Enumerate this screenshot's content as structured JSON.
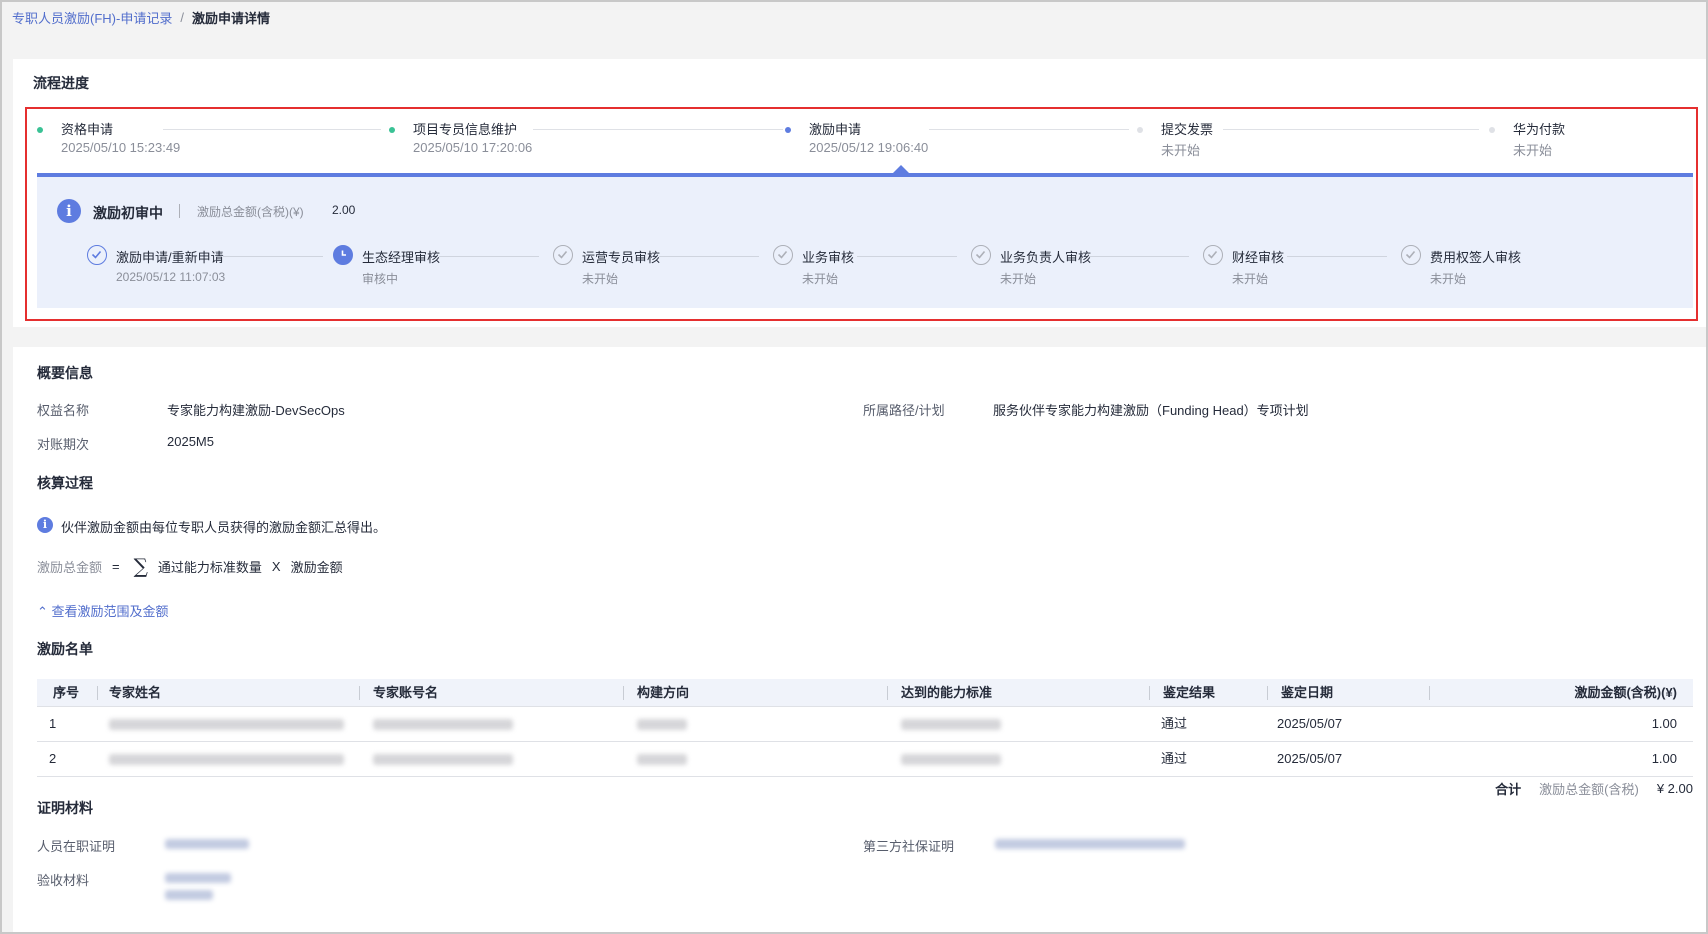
{
  "breadcrumb": {
    "parent": "专职人员激励(FH)-申请记录",
    "separator": "/",
    "current": "激励申请详情"
  },
  "progress": {
    "title": "流程进度",
    "steps": [
      {
        "name": "资格申请",
        "time": "2025/05/10 15:23:49",
        "status": "done"
      },
      {
        "name": "项目专员信息维护",
        "time": "2025/05/10 17:20:06",
        "status": "done"
      },
      {
        "name": "激励申请",
        "time": "2025/05/12 19:06:40",
        "status": "current"
      },
      {
        "name": "提交发票",
        "time": "未开始",
        "status": "pending"
      },
      {
        "name": "华为付款",
        "time": "未开始",
        "status": "pending"
      }
    ],
    "sub": {
      "status": "激励初审中",
      "amount_label": "激励总金额(含税)(¥)",
      "amount_value": "2.00",
      "steps": [
        {
          "name": "激励申请/重新申请",
          "time": "2025/05/12 11:07:03",
          "status": "done"
        },
        {
          "name": "生态经理审核",
          "time": "审核中",
          "status": "current"
        },
        {
          "name": "运营专员审核",
          "time": "未开始",
          "status": "pending"
        },
        {
          "name": "业务审核",
          "time": "未开始",
          "status": "pending"
        },
        {
          "name": "业务负责人审核",
          "time": "未开始",
          "status": "pending"
        },
        {
          "name": "财经审核",
          "time": "未开始",
          "status": "pending"
        },
        {
          "name": "费用权签人审核",
          "time": "未开始",
          "status": "pending"
        }
      ]
    }
  },
  "overview": {
    "title": "概要信息",
    "fields": {
      "benefit_name_label": "权益名称",
      "benefit_name_value": "专家能力构建激励-DevSecOps",
      "path_label": "所属路径/计划",
      "path_value": "服务伙伴专家能力构建激励（Funding Head）专项计划",
      "period_label": "对账期次",
      "period_value": "2025M5"
    }
  },
  "calculation": {
    "title": "核算过程",
    "notice": "伙伴激励金额由每位专职人员获得的激励金额汇总得出。",
    "formula": {
      "label": "激励总金额",
      "equals": "=",
      "sigma": "∑",
      "term1": "通过能力标准数量",
      "times": "X",
      "term2": "激励金额"
    },
    "expand_link": "查看激励范围及金额"
  },
  "list": {
    "title": "激励名单",
    "columns": [
      "序号",
      "专家姓名",
      "专家账号名",
      "构建方向",
      "达到的能力标准",
      "鉴定结果",
      "鉴定日期",
      "激励金额(含税)(¥)"
    ],
    "rows": [
      {
        "index": "1",
        "result": "通过",
        "date": "2025/05/07",
        "amount": "1.00"
      },
      {
        "index": "2",
        "result": "通过",
        "date": "2025/05/07",
        "amount": "1.00"
      }
    ],
    "total_label": "合计",
    "total_amount_label": "激励总金额(含税)",
    "total_amount": "¥ 2.00"
  },
  "proof": {
    "title": "证明材料",
    "employment_label": "人员在职证明",
    "social_security_label": "第三方社保证明",
    "acceptance_label": "验收材料"
  },
  "colors": {
    "primary": "#5e7ce0",
    "done_dot": "#3ac295",
    "pending_dot": "#dfe1e6",
    "highlight_border": "#e52f2f",
    "sub_panel_bg": "#ebf0fb"
  }
}
